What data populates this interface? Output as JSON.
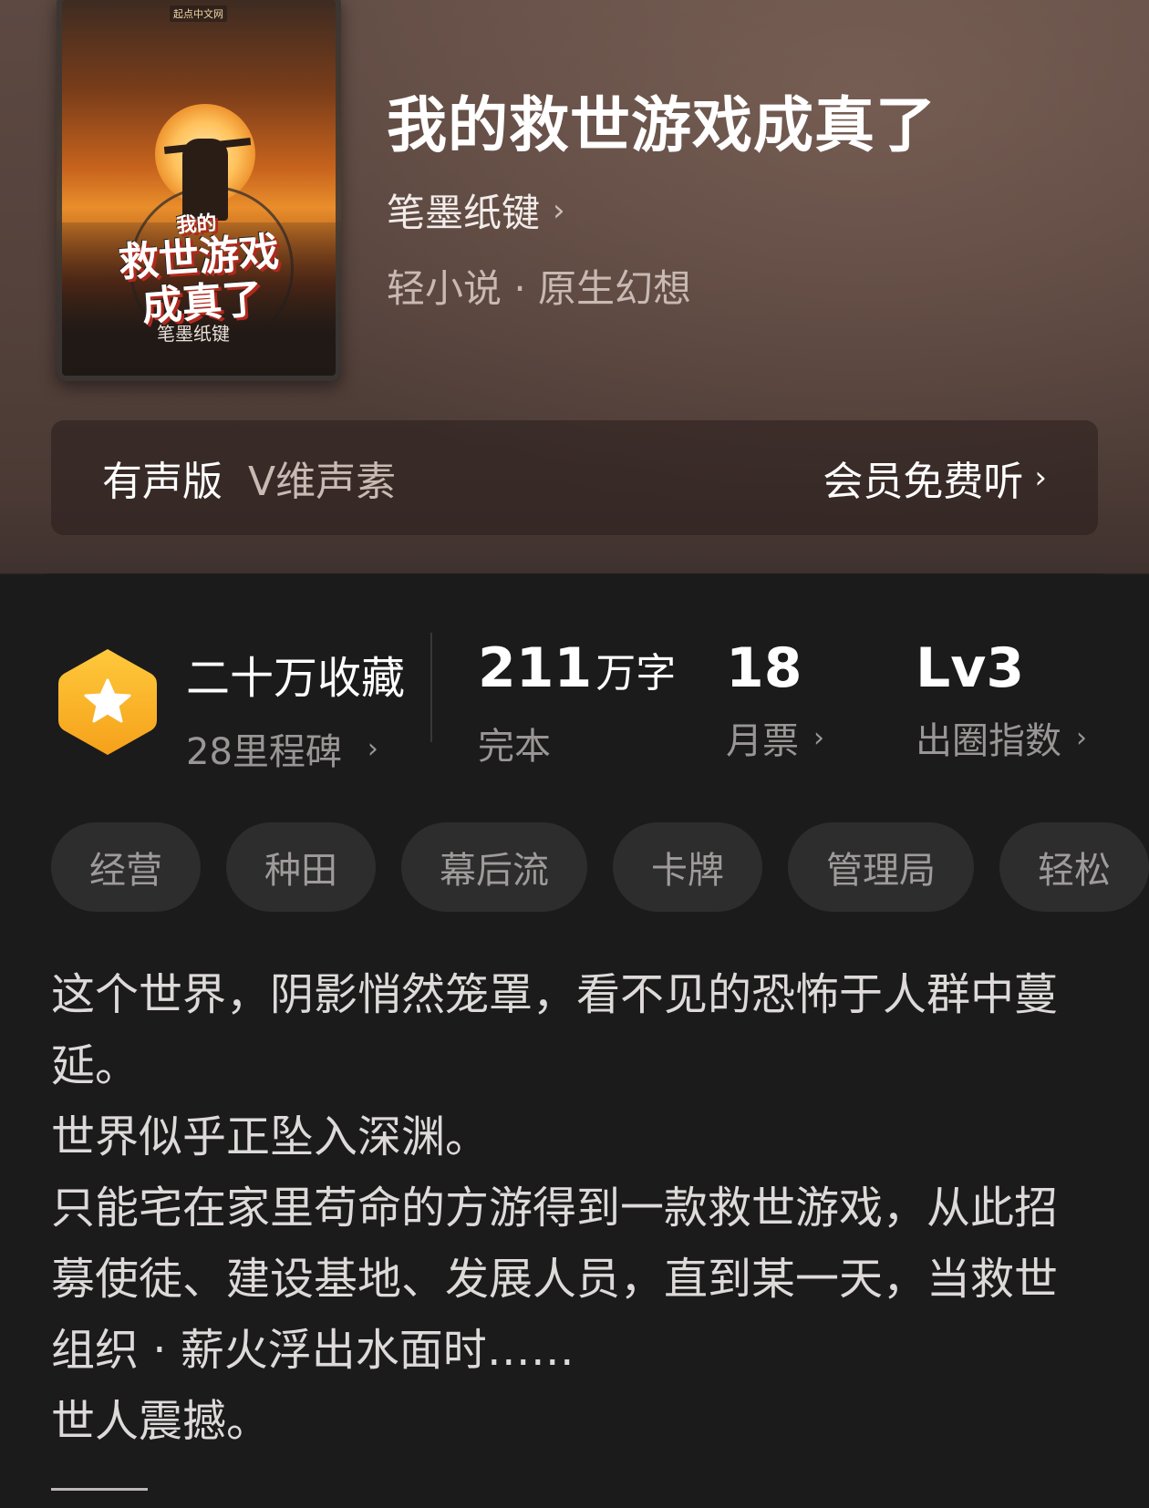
{
  "cover": {
    "publisher": "起点中文网",
    "title_line1": "我的",
    "title_line2": "救世游戏",
    "title_line3": "成真了",
    "author": "笔墨纸键"
  },
  "book": {
    "title": "我的救世游戏成真了",
    "author": "笔墨纸键",
    "author_chevron": "›",
    "genre": "轻小说 · 原生幻想"
  },
  "audio": {
    "label": "有声版",
    "voice": "V维声素",
    "action": "会员免费听",
    "chevron": "›"
  },
  "stats": {
    "collections": "二十万收藏",
    "milestones": "28里程碑",
    "words_number": "211",
    "words_unit": "万字",
    "status": "完本",
    "monthly_votes": "18",
    "monthly_votes_label": "月票",
    "level": "Lv3",
    "level_label": "出圈指数",
    "chevron": "›"
  },
  "tags": [
    "经营",
    "种田",
    "幕后流",
    "卡牌",
    "管理局",
    "轻松"
  ],
  "synopsis": [
    "这个世界，阴影悄然笼罩，看不见的恐怖于人群中蔓延。",
    "世界似乎正坠入深渊。",
    "只能宅在家里苟命的方游得到一款救世游戏，从此招募使徒、建设基地、发展人员，直到某一天，当救世组织 · 薪火浮出水面时……",
    "世人震撼。"
  ],
  "colors": {
    "badge": "#f6b32e",
    "panel_bg": "#1c1b1c",
    "tag_bg": "#2e2d2e"
  }
}
